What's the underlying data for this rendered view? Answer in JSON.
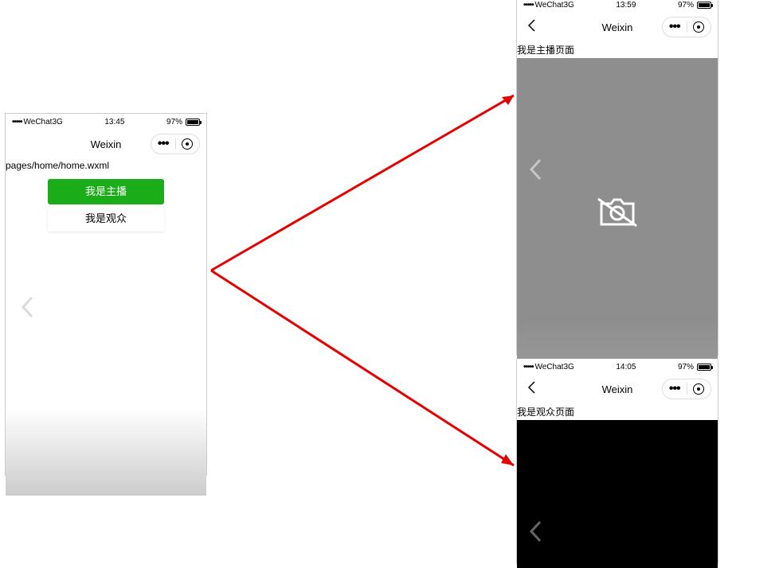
{
  "common": {
    "carrier_dots": "•••••",
    "carrier_name": "WeChat3G",
    "battery_pct": "97%",
    "nav_title": "Weixin",
    "capsule_menu": "•••"
  },
  "home": {
    "time": "13:45",
    "page_path": "pages/home/home.wxml",
    "button_anchor": "我是主播",
    "button_audience": "我是观众"
  },
  "anchor": {
    "time": "13:59",
    "page_label": "我是主播页面"
  },
  "audience": {
    "time": "14:05",
    "page_label": "我是观众页面"
  }
}
